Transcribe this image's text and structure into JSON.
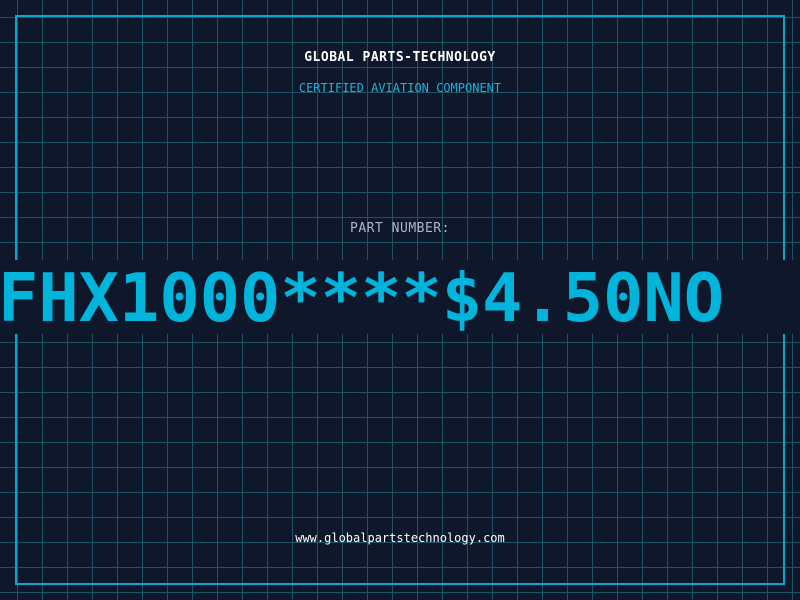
{
  "header": {
    "brand": "GLOBAL PARTS-TECHNOLOGY",
    "tagline": "CERTIFIED AVIATION COMPONENT"
  },
  "part": {
    "label": "PART NUMBER:",
    "value": "FHX1000****$4.50NO"
  },
  "footer": {
    "website": "www.globalpartstechnology.com"
  },
  "colors": {
    "background": "#0f172a",
    "grid": "#1f5367",
    "accent": "#00b4dc",
    "frame": "#0ea5c9"
  }
}
